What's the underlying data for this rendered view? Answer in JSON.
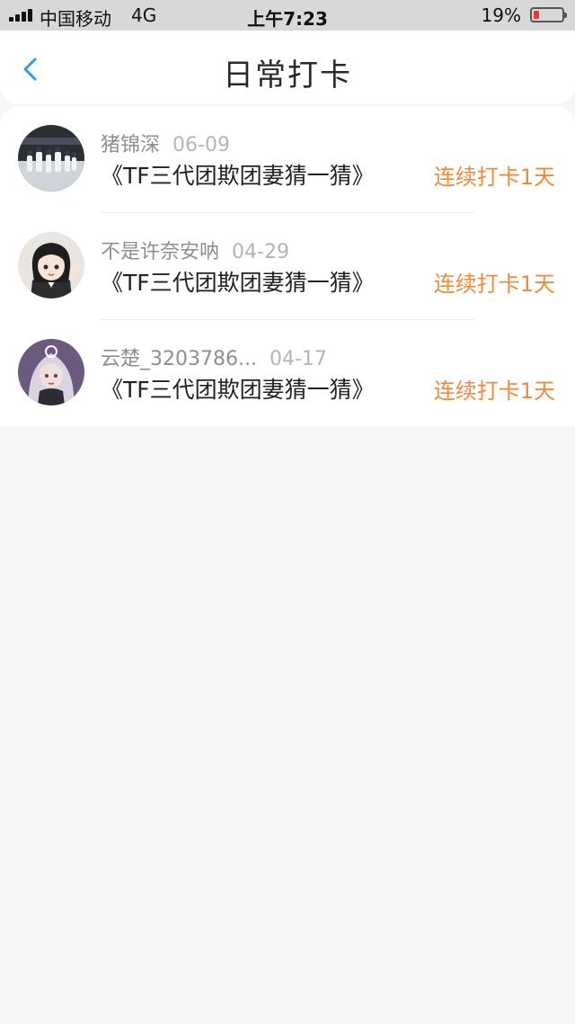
{
  "status_bar": {
    "carrier": "中国移动",
    "network": "4G",
    "time": "上午7:23",
    "battery_percent": "19%",
    "battery_level": 0.19
  },
  "header": {
    "title": "日常打卡",
    "back_icon": "chevron-left-icon"
  },
  "colors": {
    "accent": "#2f9be6",
    "streak": "#f08a3c"
  },
  "checkins": [
    {
      "username": "猪锦深",
      "date": "06-09",
      "content": "《TF三代团欺团妻猜一猜》",
      "streak": "连续打卡1天"
    },
    {
      "username": "不是许奈安呐",
      "date": "04-29",
      "content": "《TF三代团欺团妻猜一猜》",
      "streak": "连续打卡1天"
    },
    {
      "username": "云楚_3203786...",
      "date": "04-17",
      "content": "《TF三代团欺团妻猜一猜》",
      "streak": "连续打卡1天"
    }
  ]
}
